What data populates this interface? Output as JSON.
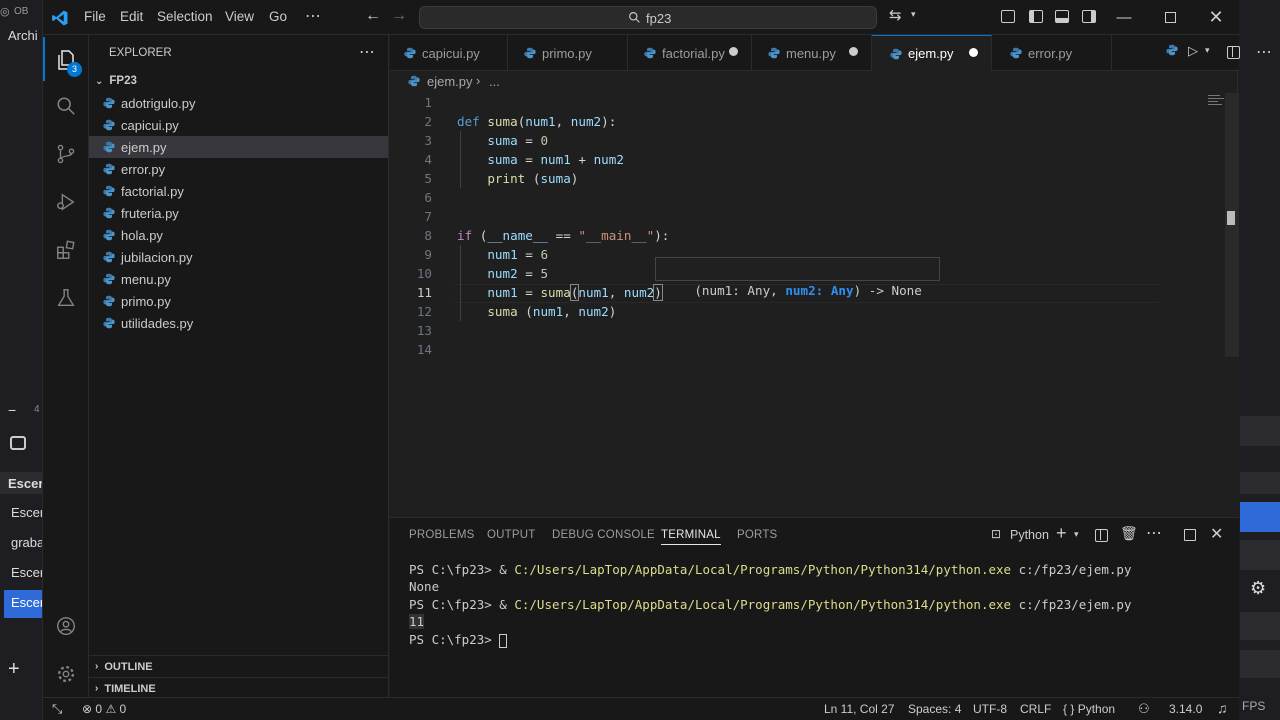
{
  "background_app": {
    "left_texts": [
      "OB",
      "Archi",
      "Escer",
      "Escer",
      "graba",
      "Escer",
      "Escer"
    ],
    "left_counter": "4"
  },
  "titlebar": {
    "menu": [
      "File",
      "Edit",
      "Selection",
      "View",
      "Go"
    ],
    "search_text": "fp23"
  },
  "activity": {
    "explorer_badge": "3"
  },
  "sidebar": {
    "title": "EXPLORER",
    "folder": "FP23",
    "files": [
      {
        "name": "adotrigulo.py"
      },
      {
        "name": "capicui.py"
      },
      {
        "name": "ejem.py"
      },
      {
        "name": "error.py"
      },
      {
        "name": "factorial.py"
      },
      {
        "name": "fruteria.py"
      },
      {
        "name": "hola.py"
      },
      {
        "name": "jubilacion.py"
      },
      {
        "name": "menu.py"
      },
      {
        "name": "primo.py"
      },
      {
        "name": "utilidades.py"
      }
    ],
    "outline": "OUTLINE",
    "timeline": "TIMELINE"
  },
  "tabs": [
    {
      "label": "capicui.py"
    },
    {
      "label": "primo.py"
    },
    {
      "label": "factorial.py"
    },
    {
      "label": "menu.py"
    },
    {
      "label": "ejem.py"
    },
    {
      "label": "error.py"
    }
  ],
  "breadcrumb": {
    "file": "ejem.py",
    "rest": "..."
  },
  "editor": {
    "line_numbers": [
      "1",
      "2",
      "3",
      "4",
      "5",
      "6",
      "7",
      "8",
      "9",
      "10",
      "11",
      "12",
      "13",
      "14"
    ],
    "current_line": "11",
    "hover_text": "(num1: Any, num2: Any) -> None"
  },
  "panel": {
    "tabs": [
      "PROBLEMS",
      "OUTPUT",
      "DEBUG CONSOLE",
      "TERMINAL",
      "PORTS"
    ],
    "active_tab": "TERMINAL",
    "terminal_name": "Python",
    "lines": [
      {
        "prompt": "PS C:\\fp23> & ",
        "path": "C:/Users/LapTop/AppData/Local/Programs/Python/Python314/python.exe",
        "arg": " c:/fp23/ejem.py"
      },
      {
        "output": "None"
      },
      {
        "prompt": "PS C:\\fp23> & ",
        "path": "C:/Users/LapTop/AppData/Local/Programs/Python/Python314/python.exe",
        "arg": " c:/fp23/ejem.py"
      },
      {
        "output": "11"
      },
      {
        "prompt": "PS C:\\fp23> "
      }
    ]
  },
  "statusbar": {
    "errors": "0",
    "warnings": "0",
    "position": "Ln 11, Col 27",
    "spaces": "Spaces: 4",
    "encoding": "UTF-8",
    "eol": "CRLF",
    "language": "Python",
    "python_version": "3.14.0",
    "right_edge": "FPS"
  },
  "colors": {
    "accent": "#0078d4",
    "keyword": "#569cd6",
    "function": "#dcdcaa",
    "variable": "#9cdcfe",
    "number": "#b5cea8",
    "string": "#ce9178"
  }
}
